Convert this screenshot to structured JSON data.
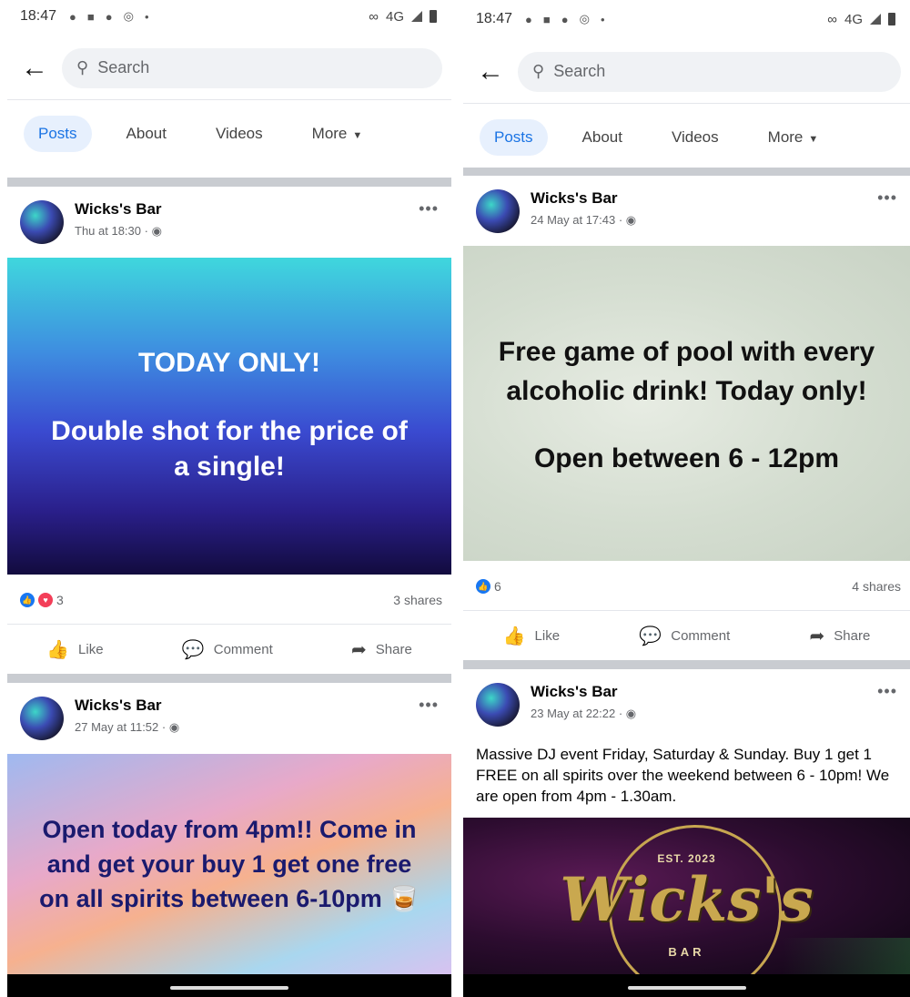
{
  "status_bar": {
    "time": "18:47",
    "network": "4G"
  },
  "search": {
    "placeholder": "Search"
  },
  "tabs": [
    {
      "label": "Posts",
      "active": true
    },
    {
      "label": "About"
    },
    {
      "label": "Videos"
    },
    {
      "label": "More"
    }
  ],
  "actions": {
    "like": "Like",
    "comment": "Comment",
    "share": "Share"
  },
  "left_screen": {
    "posts": [
      {
        "author": "Wicks's Bar",
        "timestamp": "Thu at 18:30 ·",
        "image_text_1": "TODAY ONLY!",
        "image_text_2": "Double shot for the price of a single!",
        "reaction_count": "3",
        "shares": "3 shares"
      },
      {
        "author": "Wicks's Bar",
        "timestamp": "27 May at 11:52 ·",
        "image_text": "Open today from 4pm!! Come in and get your buy 1 get one free on all spirits between 6-10pm"
      }
    ]
  },
  "right_screen": {
    "posts": [
      {
        "author": "Wicks's Bar",
        "timestamp": "24 May at 17:43 ·",
        "image_text_1": "Free game of pool with every alcoholic drink! Today only!",
        "image_text_2": "Open between 6 - 12pm",
        "reaction_count": "6",
        "shares": "4 shares"
      },
      {
        "author": "Wicks's Bar",
        "timestamp": "23 May at 22:22 ·",
        "text": "Massive DJ event Friday, Saturday & Sunday. Buy 1 get 1 FREE on all spirits over the weekend between 6 - 10pm! We are open from 4pm - 1.30am.",
        "logo_est": "EST. 2023",
        "logo_name": "Wicks's",
        "logo_bar": "BAR"
      }
    ]
  },
  "colors": {
    "accent": "#1b74e4",
    "like": "#1877f2",
    "love": "#f33e58"
  }
}
